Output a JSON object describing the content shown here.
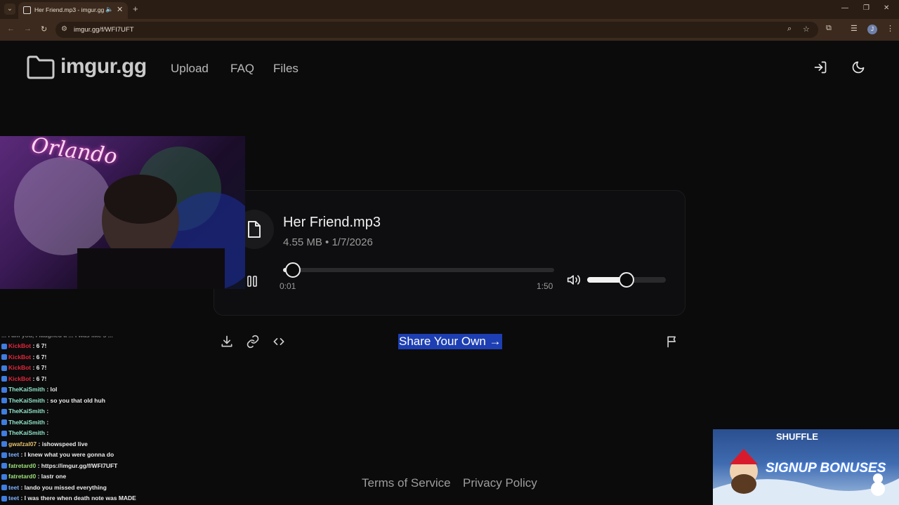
{
  "browser": {
    "tab_title": "Her Friend.mp3 - imgur.gg",
    "url": "imgur.gg/f/WFI7UFT",
    "profile_initial": "J"
  },
  "site": {
    "logo_text": "imgur.gg",
    "nav": [
      "Upload",
      "FAQ",
      "Files"
    ]
  },
  "player": {
    "file_name": "Her Friend.mp3",
    "file_meta": "4.55 MB • 1/7/2026",
    "current_time": "0:01",
    "duration": "1:50",
    "progress_fraction": 0.01,
    "volume_fraction": 0.5
  },
  "actions": {
    "share_label": "Share Your Own →"
  },
  "footer": {
    "terms": "Terms of Service",
    "privacy": "Privacy Policy"
  },
  "chat": {
    "top_partial": "... I am you, I laughed a ... I was like 5 ...",
    "messages": [
      {
        "user": "KickBot",
        "text": ": 6 7!",
        "color": "#e0273a"
      },
      {
        "user": "KickBot",
        "text": ": 6 7!",
        "color": "#e0273a"
      },
      {
        "user": "KickBot",
        "text": ": 6 7!",
        "color": "#e0273a"
      },
      {
        "user": "KickBot",
        "text": ": 6 7!",
        "color": "#e0273a"
      },
      {
        "user": "TheKaiSmith",
        "text": ": lol",
        "color": "#8fe3c7"
      },
      {
        "user": "TheKaiSmith",
        "text": ": so you that old huh",
        "color": "#8fe3c7"
      },
      {
        "user": "TheKaiSmith",
        "text": ":",
        "color": "#8fe3c7"
      },
      {
        "user": "TheKaiSmith",
        "text": ":",
        "color": "#8fe3c7"
      },
      {
        "user": "TheKaiSmith",
        "text": ":",
        "color": "#8fe3c7"
      },
      {
        "user": "gwafzal07",
        "text": ": ishowspeed live",
        "color": "#e5c06a"
      },
      {
        "user": "teet",
        "text": ": I knew what you were gonna do",
        "color": "#7fb2ff"
      },
      {
        "user": "fatretard0",
        "text": ": https://imgur.gg/f/WFI7UFT",
        "color": "#9de27a"
      },
      {
        "user": "fatretard0",
        "text": ": lastr one",
        "color": "#9de27a"
      },
      {
        "user": "teet",
        "text": ": lando you missed everything",
        "color": "#7fb2ff"
      },
      {
        "user": "teet",
        "text": ": I was there when death note was MADE",
        "color": "#7fb2ff"
      }
    ]
  },
  "ad": {
    "brand": "SHUFFLE",
    "headline": "SIGNUP BONUSES"
  },
  "webcam": {
    "neon_sign": "Orlando"
  }
}
